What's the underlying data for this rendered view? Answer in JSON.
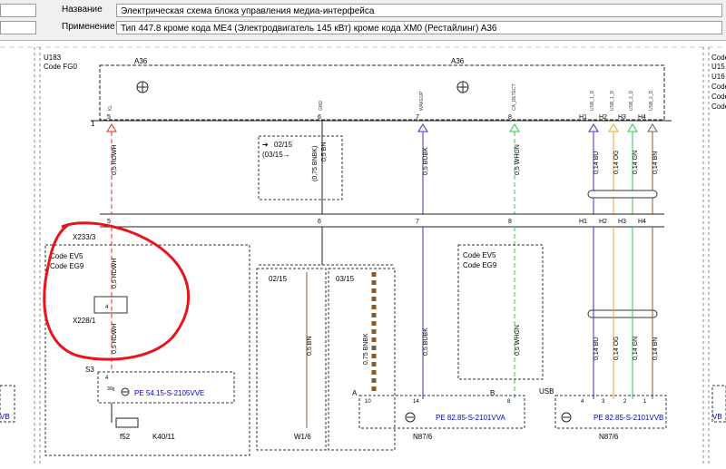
{
  "header": {
    "rows": [
      {
        "label": "Название",
        "value": "Электрическая схема блока управления медиа-интерфейса"
      },
      {
        "label": "Применение",
        "value": "Тип 447.8 кроме кода ME4 (Электродвигатель 145 кВт) кроме кода XM0 (Рестайлинг) A36"
      }
    ]
  },
  "colors": {
    "red": "#e0302a",
    "orange": "#f5a12e",
    "green": "#36c653",
    "blue": "#3535c0",
    "brown": "#8b5a2b",
    "annotation_red": "#e8141a",
    "link_blue": "#0000cc"
  },
  "diagram": {
    "left_codes": [
      "U183",
      "Code FG0"
    ],
    "right_codes": [
      "Code",
      "U15",
      "U16",
      "Code",
      "Code",
      "Code"
    ],
    "module_label": "A36",
    "module_label_2": "A36",
    "left_edge_label": "1",
    "pin_numbers": [
      "5",
      "6",
      "7",
      "8",
      "H1",
      "H2",
      "H3",
      "H4"
    ],
    "pin_signals": [
      "KL",
      "GND",
      "WAKEUP",
      "CA_DETECT",
      "USB_1_D",
      "USB_1_D",
      "USB_2_D",
      "USB_2_D"
    ],
    "wires": [
      {
        "name": "0.5 RDWH",
        "color": "red"
      },
      {
        "name": "0.5 BN",
        "color": "brown"
      },
      {
        "name": "0.5 BUBK",
        "color": "blue"
      },
      {
        "name": "0.5 WHGN",
        "color": "green"
      },
      {
        "name": "0.14 BU",
        "color": "blue"
      },
      {
        "name": "0.14 OG",
        "color": "orange"
      },
      {
        "name": "0.14 GN",
        "color": "green"
      },
      {
        "name": "0.14 BN",
        "color": "brown"
      }
    ],
    "mid_labels": {
      "rdwh": "0,5 RDWH",
      "bn": "0,5 BN",
      "bn_alt": "(0,75 BNBK)",
      "bubk": "0,5 BUBK",
      "whgn": "0,5 WHGN",
      "bu": "0,14 BU",
      "og": "0,14 OG",
      "gn": "0,14 GN",
      "bn14": "0,14 BN",
      "bnbk075": "0,75 BNBK"
    },
    "date_box_1": {
      "arrow": "➔",
      "line1": "02/15",
      "line2": "(03/15→"
    },
    "x233": "X233/3",
    "code_box_left": [
      "Code EV5",
      "Code EG9"
    ],
    "x228": "X228/1",
    "pin4": "4",
    "s3": "S3",
    "s3_pins": [
      "4",
      "30g"
    ],
    "link_1": "PE 54.15-S-2105VVE",
    "f52": "f52",
    "k40": "K40/11",
    "date_02": "02/15",
    "date_03": "03/15",
    "w16": "W1/6",
    "code_box_right": [
      "Code EV5",
      "Code EG9"
    ],
    "conn_a": "A",
    "conn_a_pins": [
      "10",
      "14"
    ],
    "conn_b": "B",
    "conn_b_pins": [
      "8"
    ],
    "usb": "USB",
    "usb_pins": [
      "4",
      "3",
      "2",
      "1"
    ],
    "link_2": "PE 82.85-S-2101VVA",
    "link_3": "PE 82.85-S-2101VVB",
    "n87_1": "N87/6",
    "n87_2": "N87/6",
    "left_link": "VB",
    "right_link": "VB"
  }
}
